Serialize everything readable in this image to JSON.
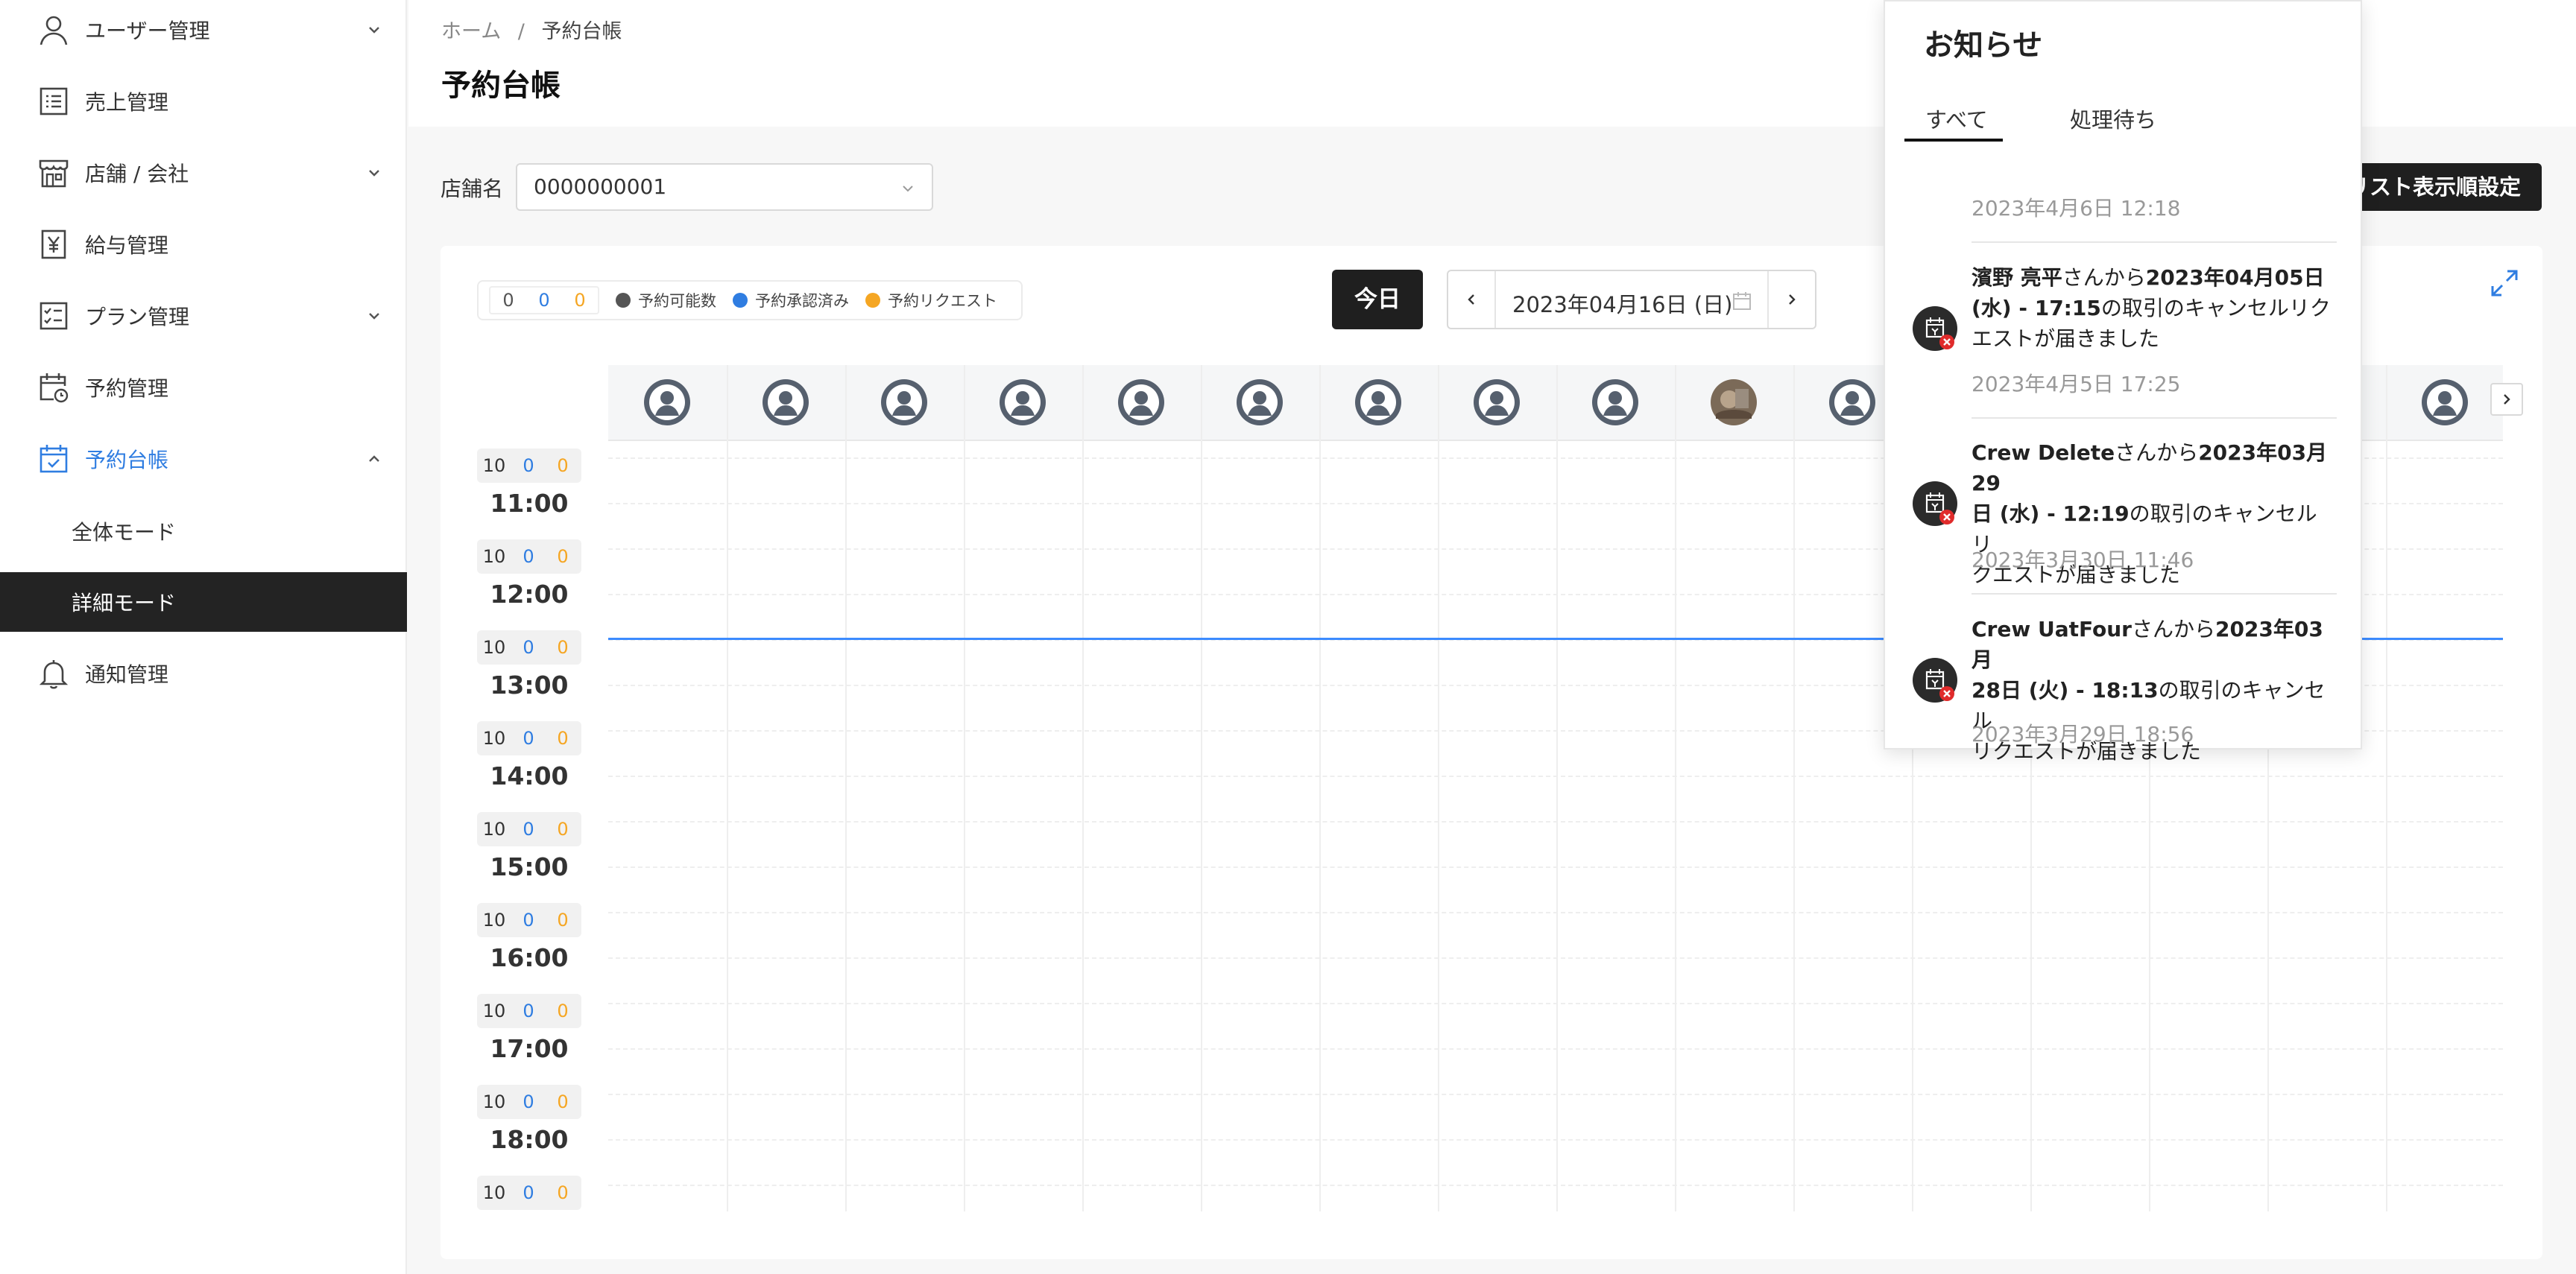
{
  "sidebar": {
    "items": [
      {
        "label": "ユーザー管理",
        "icon": "user-icon",
        "expandable": true
      },
      {
        "label": "売上管理",
        "icon": "list-icon",
        "expandable": false
      },
      {
        "label": "店舗 / 会社",
        "icon": "store-icon",
        "expandable": true
      },
      {
        "label": "給与管理",
        "icon": "yen-doc-icon",
        "expandable": false
      },
      {
        "label": "プラン管理",
        "icon": "checklist-icon",
        "expandable": true
      },
      {
        "label": "予約管理",
        "icon": "calendar-clock-icon",
        "expandable": false
      },
      {
        "label": "予約台帳",
        "icon": "calendar-check-icon",
        "expandable": true,
        "active": true
      },
      {
        "label": "通知管理",
        "icon": "bell-icon",
        "expandable": false
      }
    ],
    "sub_items": [
      {
        "label": "全体モード"
      },
      {
        "label": "詳細モード",
        "selected": true
      }
    ]
  },
  "header": {
    "breadcrumb_home": "ホーム",
    "breadcrumb_sep": "/",
    "breadcrumb_current": "予約台帳",
    "title": "予約台帳"
  },
  "filters": {
    "store_label": "店舗名",
    "store_value": "0000000001",
    "list_order_button": "リスト表示順設定"
  },
  "legend": {
    "count_available": "0",
    "count_approved": "0",
    "count_request": "0",
    "available": "予約可能数",
    "approved": "予約承認済み",
    "request": "予約リクエスト"
  },
  "date_nav": {
    "today_button": "今日",
    "date": "2023年04月16日 (日)"
  },
  "time_slots": [
    {
      "time": "11:00",
      "cap": "10",
      "approved": "0",
      "request": "0"
    },
    {
      "time": "12:00",
      "cap": "10",
      "approved": "0",
      "request": "0"
    },
    {
      "time": "13:00",
      "cap": "10",
      "approved": "0",
      "request": "0"
    },
    {
      "time": "14:00",
      "cap": "10",
      "approved": "0",
      "request": "0"
    },
    {
      "time": "15:00",
      "cap": "10",
      "approved": "0",
      "request": "0"
    },
    {
      "time": "16:00",
      "cap": "10",
      "approved": "0",
      "request": "0"
    },
    {
      "time": "17:00",
      "cap": "10",
      "approved": "0",
      "request": "0"
    },
    {
      "time": "18:00",
      "cap": "10",
      "approved": "0",
      "request": "0"
    },
    {
      "time": "",
      "cap": "10",
      "approved": "0",
      "request": "0"
    }
  ],
  "notifications": {
    "title": "お知らせ",
    "tab_all": "すべて",
    "tab_pending": "処理待ち",
    "top_timestamp": "2023年4月6日 12:18",
    "items": [
      {
        "line1_name": "濱野 亮平",
        "line1_a": "さんから",
        "line1_b": "2023年04月05日",
        "line2_b": "(水) - 17:15",
        "line2_a": "の取引のキャンセルリク",
        "line3": "エストが届きました",
        "timestamp": "2023年4月5日 17:25"
      },
      {
        "line1_name": "Crew Delete",
        "line1_a": "さんから",
        "line1_b": "2023年03月29",
        "line2_b": "日 (水) - 12:19",
        "line2_a": "の取引のキャンセルリ",
        "line3": "クエストが届きました",
        "timestamp": "2023年3月30日 11:46"
      },
      {
        "line1_name": "Crew UatFour",
        "line1_a": "さんから",
        "line1_b": "2023年03月",
        "line2_b": "28日 (火) - 18:13",
        "line2_a": "の取引のキャンセル",
        "line3": "リクエストが届きました",
        "timestamp": "2023年3月29日 18:56"
      }
    ]
  },
  "colors": {
    "accent": "#2f7de1",
    "approved": "#2f7de1",
    "request": "#f5a623",
    "available": "#555555",
    "dark_button": "#1f1f1f",
    "now_line": "#3c8bff"
  }
}
